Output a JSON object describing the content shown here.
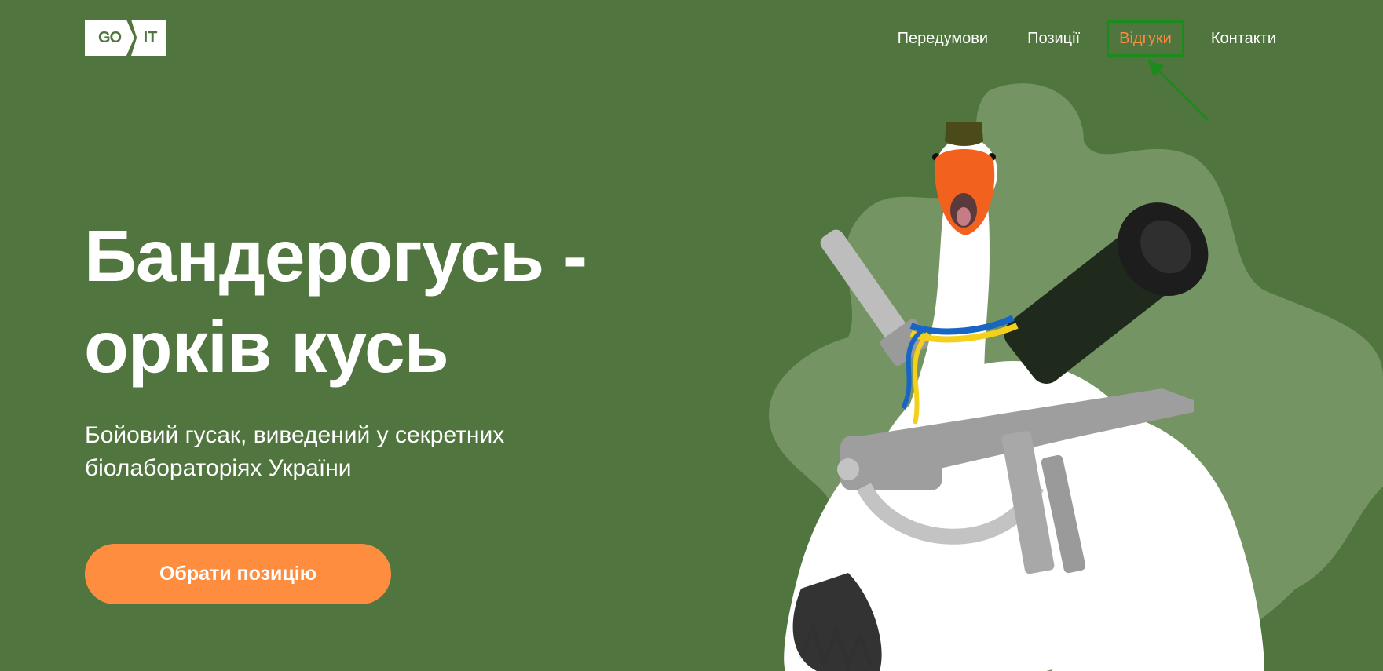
{
  "logo": {
    "left": "GO",
    "right": "IT"
  },
  "nav": {
    "items": [
      {
        "label": "Передумови"
      },
      {
        "label": "Позиції"
      },
      {
        "label": "Відгуки"
      },
      {
        "label": "Контакти"
      }
    ]
  },
  "hero": {
    "title_line1": "Бандерогусь -",
    "title_line2": "орків кусь",
    "subtitle_line1": "Бойовий гусак, виведений у секретних",
    "subtitle_line2": "біолабораторіях України",
    "cta_label": "Обрати позицію"
  },
  "colors": {
    "background": "#51753f",
    "accent": "#ff8d3f",
    "highlight_border": "#1d8a1d"
  },
  "icons": {
    "pointer": "arrow-icon"
  }
}
